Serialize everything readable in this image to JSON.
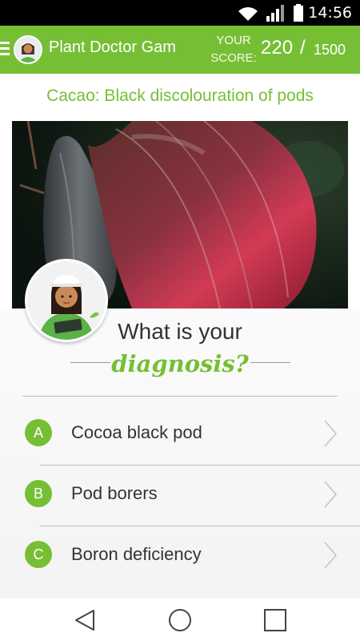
{
  "status_bar": {
    "time": "14:56",
    "icons": [
      "wifi-icon",
      "signal-icon",
      "battery-icon"
    ]
  },
  "app_bar": {
    "title": "Plant Doctor Gam",
    "score_label": "YOUR SCORE:",
    "score_value": "220",
    "score_separator": "/",
    "score_total": "1500",
    "color": "#76bf35"
  },
  "crop_title": "Cacao: Black discolouration of pods",
  "question": {
    "line1": "What is your",
    "line2": "diagnosis?"
  },
  "answers": [
    {
      "letter": "A",
      "label": "Cocoa black pod"
    },
    {
      "letter": "B",
      "label": "Pod borers"
    },
    {
      "letter": "C",
      "label": "Boron deficiency"
    }
  ],
  "nav": [
    "back-icon",
    "home-icon",
    "recents-icon"
  ]
}
